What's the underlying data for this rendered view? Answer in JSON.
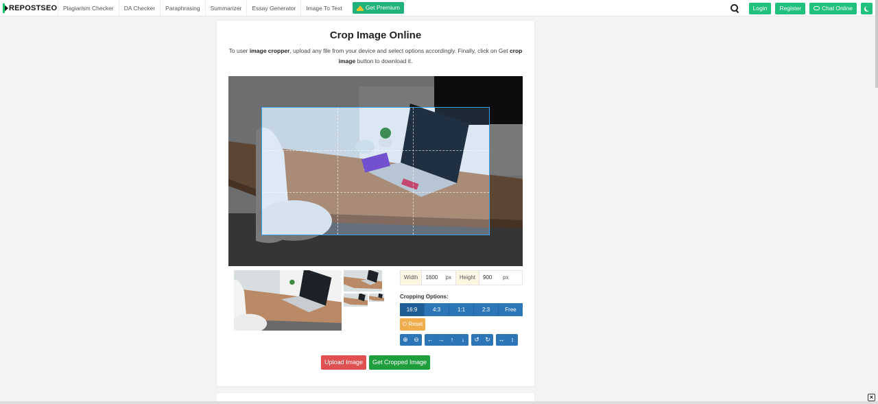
{
  "nav": {
    "logo_text": "REPOSTSEO",
    "links": [
      "Plagiarism Checker",
      "DA Checker",
      "Paraphrasing",
      "Summarizer",
      "Essay Generator",
      "Image To Text"
    ],
    "premium_label": "Get Premium",
    "login_label": "Login",
    "register_label": "Register",
    "chat_label": "Chat Online"
  },
  "main": {
    "title": "Crop Image Online",
    "desc_pre": "To user ",
    "desc_b1": "image cropper",
    "desc_mid": ", upload any file from your device and select options accordingly. Finally, click on Get ",
    "desc_b2": "crop image",
    "desc_post": " button to download it."
  },
  "controls": {
    "width_label": "Width",
    "width_value": "1600",
    "height_label": "Height",
    "height_value": "900",
    "unit": "px",
    "cropping_label": "Cropping Options:",
    "ratios": [
      "16:9",
      "4:3",
      "1:1",
      "2:3",
      "Free"
    ],
    "active_ratio": "16:9",
    "reset_label": "Reset",
    "tools": [
      "⊕",
      "⊖",
      "←",
      "→",
      "↑",
      "↓",
      "↺",
      "↻",
      "↔",
      "↕"
    ]
  },
  "actions": {
    "upload_label": "Upload Image",
    "get_cropped_label": "Get Cropped Image"
  },
  "colors": {
    "brand_green": "#20c07d",
    "primary_blue": "#2c76b8",
    "reset_orange": "#f0ad4e",
    "upload_red": "#e05050"
  }
}
